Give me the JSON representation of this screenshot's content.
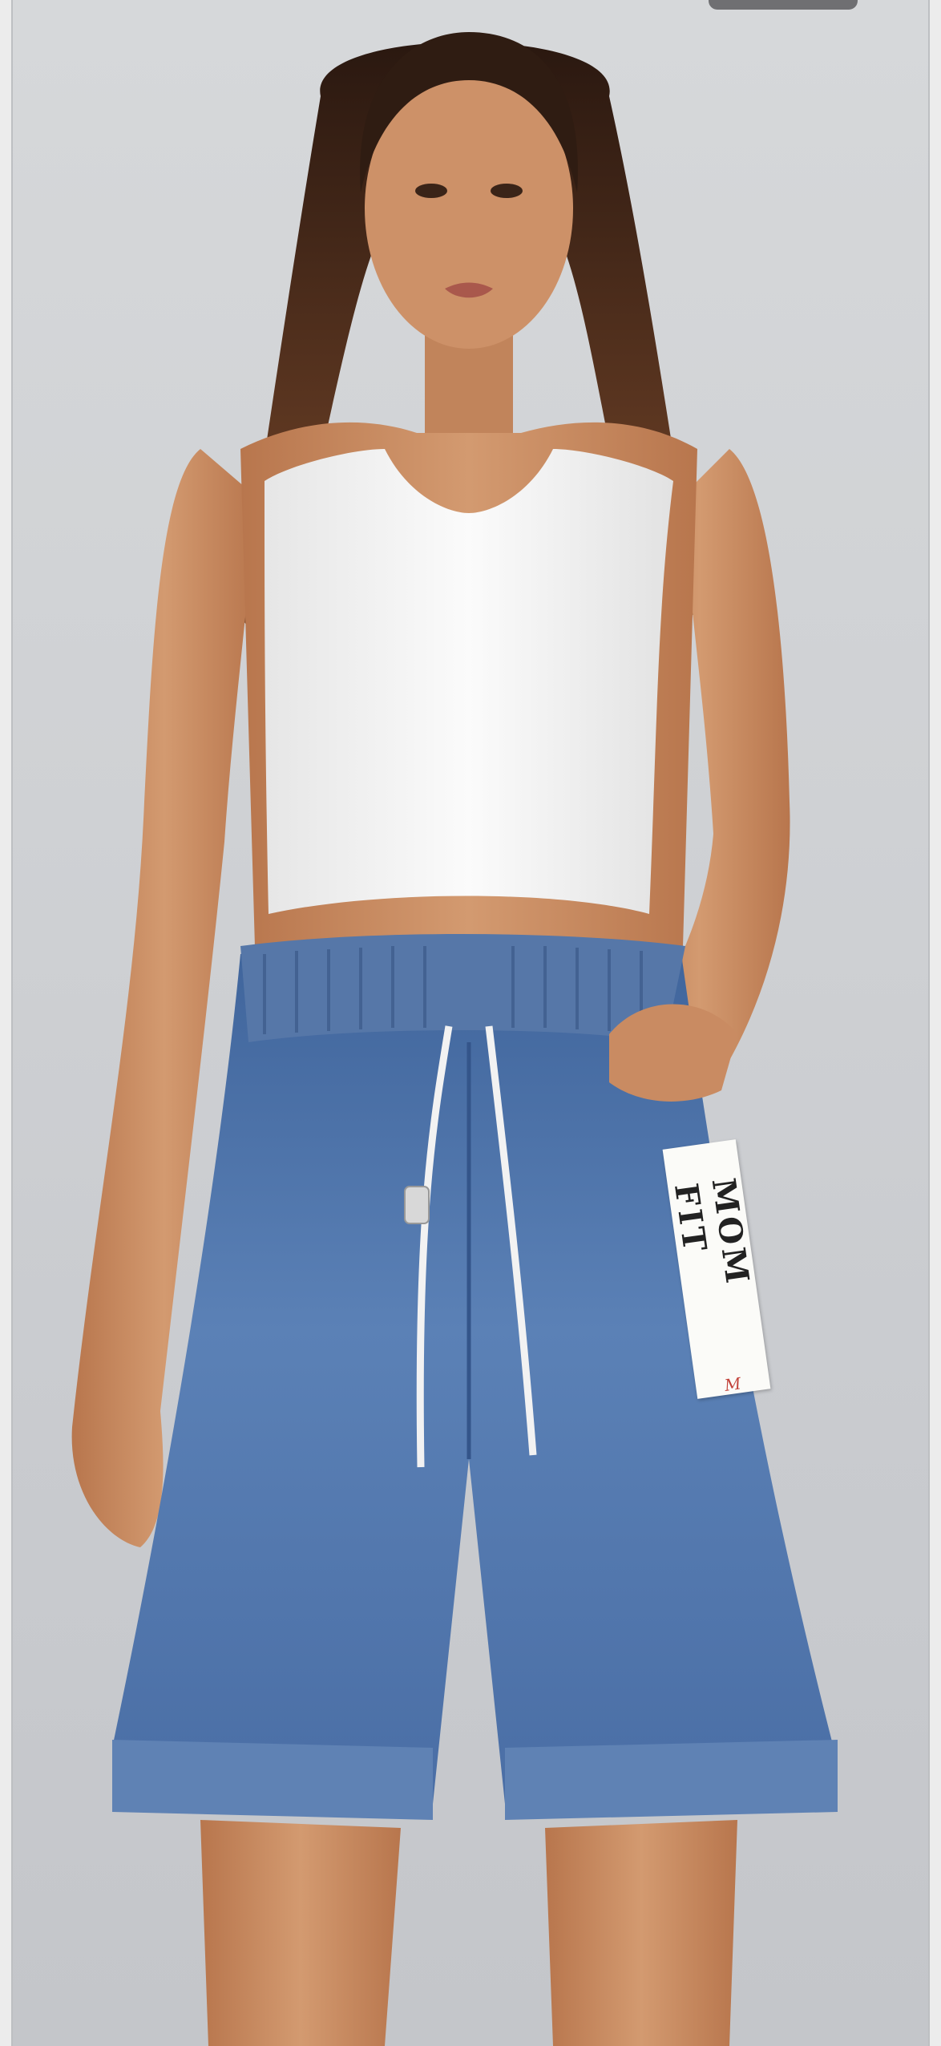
{
  "image": {
    "description_colors": {
      "background": "#cfd1d4",
      "tank_top": "#f4f4f4",
      "denim": "#4a6fa5",
      "skin": "#c98b62",
      "hair": "#3b2418"
    }
  },
  "product_tag": {
    "text": "MOM FIT",
    "mark": "M"
  }
}
